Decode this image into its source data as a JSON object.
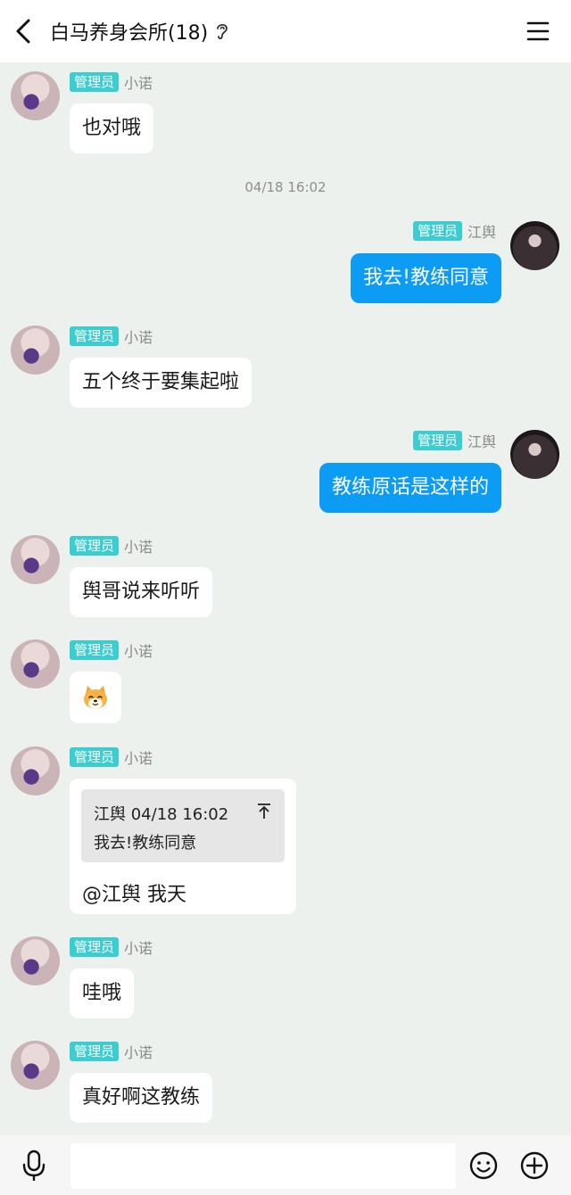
{
  "header": {
    "title": "白马养身会所(18)"
  },
  "timestamp": "04/18 16:02",
  "messages": [
    {
      "badge": "管理员",
      "sender": "小诺",
      "text": "也对哦"
    },
    {
      "badge": "管理员",
      "sender": "江舆",
      "text": "我去!教练同意"
    },
    {
      "badge": "管理员",
      "sender": "小诺",
      "text": "五个终于要集起啦"
    },
    {
      "badge": "管理员",
      "sender": "江舆",
      "text": "教练原话是这样的"
    },
    {
      "badge": "管理员",
      "sender": "小诺",
      "text": "舆哥说来听听"
    },
    {
      "badge": "管理员",
      "sender": "小诺",
      "emoji": "doge-emoji"
    },
    {
      "badge": "管理员",
      "sender": "小诺",
      "quote": {
        "header": "江舆 04/18 16:02",
        "text": "我去!教练同意"
      },
      "text": "@江舆 我天"
    },
    {
      "badge": "管理员",
      "sender": "小诺",
      "text": "哇哦"
    },
    {
      "badge": "管理员",
      "sender": "小诺",
      "text": "真好啊这教练"
    }
  ],
  "input": {
    "placeholder": ""
  },
  "colors": {
    "accent": "#0d9cf3",
    "badge": "#3ccdd1",
    "background": "#edf1ee"
  }
}
